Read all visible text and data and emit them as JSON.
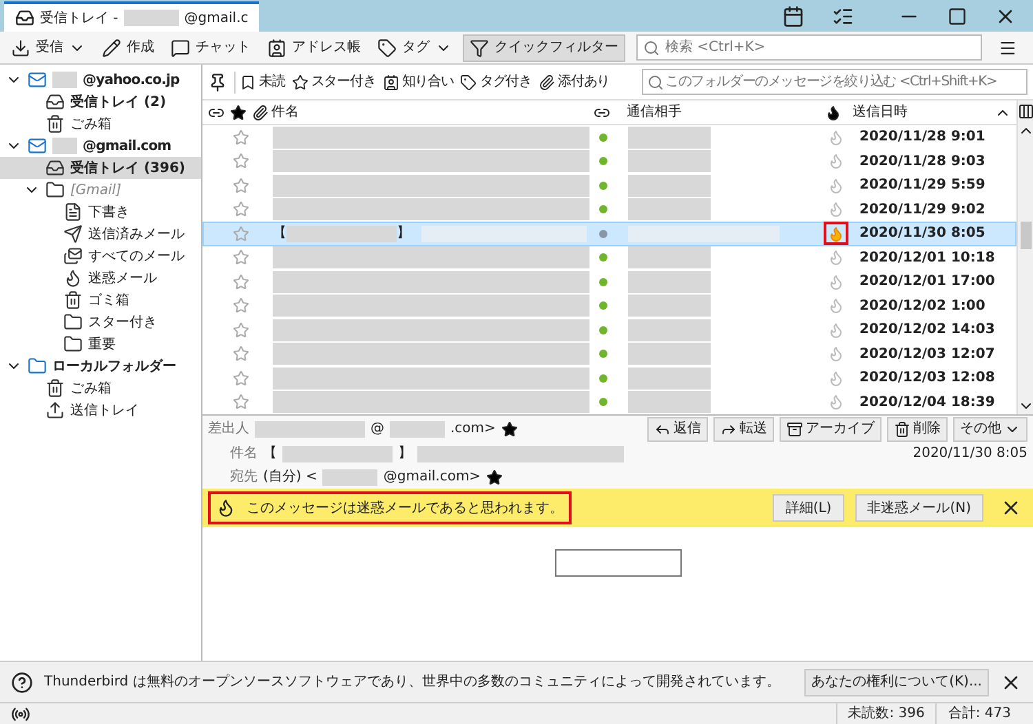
{
  "window": {
    "tab": {
      "title_prefix": "受信トレイ - ",
      "title_suffix": "@gmail.c"
    }
  },
  "toolbar": {
    "buttons": [
      {
        "kind": "get",
        "label": "受信",
        "dropdown": true,
        "pressed": false
      },
      {
        "kind": "write",
        "label": "作成",
        "dropdown": false,
        "pressed": false
      },
      {
        "kind": "chat",
        "label": "チャット",
        "dropdown": false,
        "pressed": false
      },
      {
        "kind": "address",
        "label": "アドレス帳",
        "dropdown": false,
        "pressed": false
      },
      {
        "kind": "tag",
        "label": "タグ",
        "dropdown": true,
        "pressed": false
      },
      {
        "kind": "filter",
        "label": "クイックフィルター",
        "dropdown": false,
        "pressed": true
      }
    ],
    "search": {
      "placeholder": "検索 <Ctrl+K>"
    }
  },
  "folders": [
    {
      "kind": "account",
      "label": "@yahoo.co.jp",
      "unread": true,
      "selected": false,
      "expanded": true,
      "children": [
        {
          "kind": "inbox",
          "label": "受信トレイ (2)",
          "unread": true,
          "selected": false
        },
        {
          "kind": "trash",
          "label": "ごみ箱",
          "unread": false,
          "selected": false
        }
      ]
    },
    {
      "kind": "account",
      "label": "@gmail.com",
      "unread": true,
      "selected": false,
      "expanded": true,
      "children": [
        {
          "kind": "inbox",
          "label": "受信トレイ (396)",
          "unread": true,
          "selected": true
        },
        {
          "kind": "virtual",
          "label": "[Gmail]",
          "unread": false,
          "selected": false,
          "expanded": true,
          "children": [
            {
              "kind": "drafts",
              "label": "下書き",
              "unread": false,
              "selected": false
            },
            {
              "kind": "sent",
              "label": "送信済みメール",
              "unread": false,
              "selected": false
            },
            {
              "kind": "all",
              "label": "すべてのメール",
              "unread": false,
              "selected": false
            },
            {
              "kind": "junk",
              "label": "迷惑メール",
              "unread": false,
              "selected": false
            },
            {
              "kind": "trash",
              "label": "ゴミ箱",
              "unread": false,
              "selected": false
            },
            {
              "kind": "folder",
              "label": "スター付き",
              "unread": false,
              "selected": false
            },
            {
              "kind": "folder",
              "label": "重要",
              "unread": false,
              "selected": false
            }
          ]
        }
      ]
    },
    {
      "kind": "local",
      "label": "ローカルフォルダー",
      "unread": true,
      "selected": false,
      "expanded": true,
      "children": [
        {
          "kind": "trash",
          "label": "ごみ箱",
          "unread": false,
          "selected": false
        },
        {
          "kind": "outbox",
          "label": "送信トレイ",
          "unread": false,
          "selected": false
        }
      ]
    }
  ],
  "quick_filter": {
    "buttons": [
      {
        "kind": "unread",
        "label": "未読"
      },
      {
        "kind": "starred",
        "label": "スター付き"
      },
      {
        "kind": "contact",
        "label": "知り合い"
      },
      {
        "kind": "tagged",
        "label": "タグ付き"
      },
      {
        "kind": "attachment",
        "label": "添付あり"
      }
    ],
    "placeholder": "このフォルダーのメッセージを絞り込む <Ctrl+Shift+K>"
  },
  "table": {
    "columns": {
      "subject": "件名",
      "correspondent": "通信相手",
      "date": "送信日時"
    },
    "rows": [
      {
        "date": "2020/11/28 9:01",
        "selected": false,
        "junk": false,
        "highlight": false
      },
      {
        "date": "2020/11/28 9:03",
        "selected": false,
        "junk": false,
        "highlight": false
      },
      {
        "date": "2020/11/29 5:59",
        "selected": false,
        "junk": false,
        "highlight": false
      },
      {
        "date": "2020/11/29 9:02",
        "selected": false,
        "junk": false,
        "highlight": false
      },
      {
        "date": "2020/11/30 8:05",
        "selected": true,
        "junk": true,
        "highlight": true,
        "subject_open": "【",
        "subject_close": "】"
      },
      {
        "date": "2020/12/01 10:18",
        "selected": false,
        "junk": false,
        "highlight": false
      },
      {
        "date": "2020/12/01 17:00",
        "selected": false,
        "junk": false,
        "highlight": false
      },
      {
        "date": "2020/12/02 1:00",
        "selected": false,
        "junk": false,
        "highlight": false
      },
      {
        "date": "2020/12/02 14:03",
        "selected": false,
        "junk": false,
        "highlight": false
      },
      {
        "date": "2020/12/03 12:07",
        "selected": false,
        "junk": false,
        "highlight": false
      },
      {
        "date": "2020/12/03 12:08",
        "selected": false,
        "junk": false,
        "highlight": false
      },
      {
        "date": "2020/12/04 18:39",
        "selected": false,
        "junk": false,
        "highlight": false
      }
    ]
  },
  "message_header": {
    "from": {
      "label": "差出人",
      "at": "@",
      "suffix": ".com>"
    },
    "subject": {
      "label": "件名",
      "open": "【",
      "close": "】"
    },
    "to": {
      "label": "宛先",
      "prefix": "(自分) <",
      "suffix": "@gmail.com>"
    },
    "date": "2020/11/30 8:05",
    "buttons": [
      {
        "kind": "reply",
        "label": "返信"
      },
      {
        "kind": "forward",
        "label": "転送"
      },
      {
        "kind": "archive",
        "label": "アーカイブ"
      },
      {
        "kind": "delete",
        "label": "削除"
      },
      {
        "kind": "more",
        "label": "その他"
      }
    ]
  },
  "junk_bar": {
    "message": "このメッセージは迷惑メールであると思われます。",
    "highlight": true,
    "buttons": [
      "詳細(L)",
      "非迷惑メール(N)"
    ]
  },
  "notification": {
    "message": "Thunderbird は無料のオープンソースソフトウェアであり、世界中の多数のコミュニティによって開発されています。",
    "button": "あなたの権利について(K)..."
  },
  "status_bar": {
    "unread": "未読数: 396",
    "total": "合計: 473"
  }
}
